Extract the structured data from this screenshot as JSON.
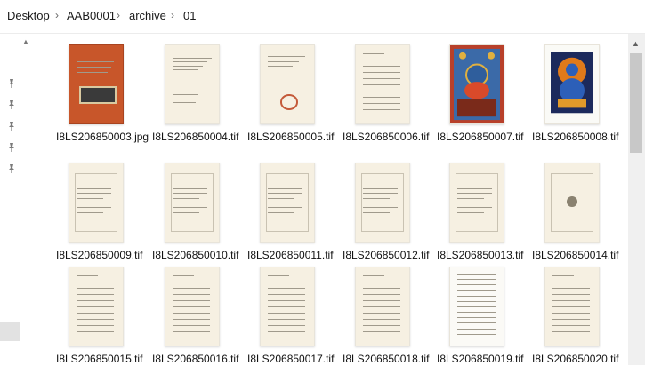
{
  "breadcrumb": {
    "items": [
      "Desktop",
      "AAB0001",
      "archive",
      "01"
    ],
    "separator": "›"
  },
  "nav": {
    "pins": [
      "pin-icon",
      "pin-icon",
      "pin-icon",
      "pin-icon",
      "pin-icon"
    ]
  },
  "files": [
    {
      "name": "I8LS206850003.jpg",
      "kind": "cover-red"
    },
    {
      "name": "I8LS206850004.tif",
      "kind": "title-page"
    },
    {
      "name": "I8LS206850005.tif",
      "kind": "title-ornament"
    },
    {
      "name": "I8LS206850006.tif",
      "kind": "text-page"
    },
    {
      "name": "I8LS206850007.tif",
      "kind": "thangka-painting"
    },
    {
      "name": "I8LS206850008.tif",
      "kind": "buddha-painting"
    },
    {
      "name": "I8LS206850009.tif",
      "kind": "framed-text"
    },
    {
      "name": "I8LS206850010.tif",
      "kind": "framed-text"
    },
    {
      "name": "I8LS206850011.tif",
      "kind": "framed-text"
    },
    {
      "name": "I8LS206850012.tif",
      "kind": "framed-text"
    },
    {
      "name": "I8LS206850013.tif",
      "kind": "framed-text"
    },
    {
      "name": "I8LS206850014.tif",
      "kind": "framed-emblem"
    },
    {
      "name": "I8LS206850015.tif",
      "kind": "text-page"
    },
    {
      "name": "I8LS206850016.tif",
      "kind": "text-page"
    },
    {
      "name": "I8LS206850017.tif",
      "kind": "text-page"
    },
    {
      "name": "I8LS206850018.tif",
      "kind": "text-page"
    },
    {
      "name": "I8LS206850019.tif",
      "kind": "index-page"
    },
    {
      "name": "I8LS206850020.tif",
      "kind": "text-page"
    }
  ],
  "colors": {
    "page": "#f6f0e2",
    "cover_red": "#c8562a",
    "selection": "#e2e2e2"
  }
}
